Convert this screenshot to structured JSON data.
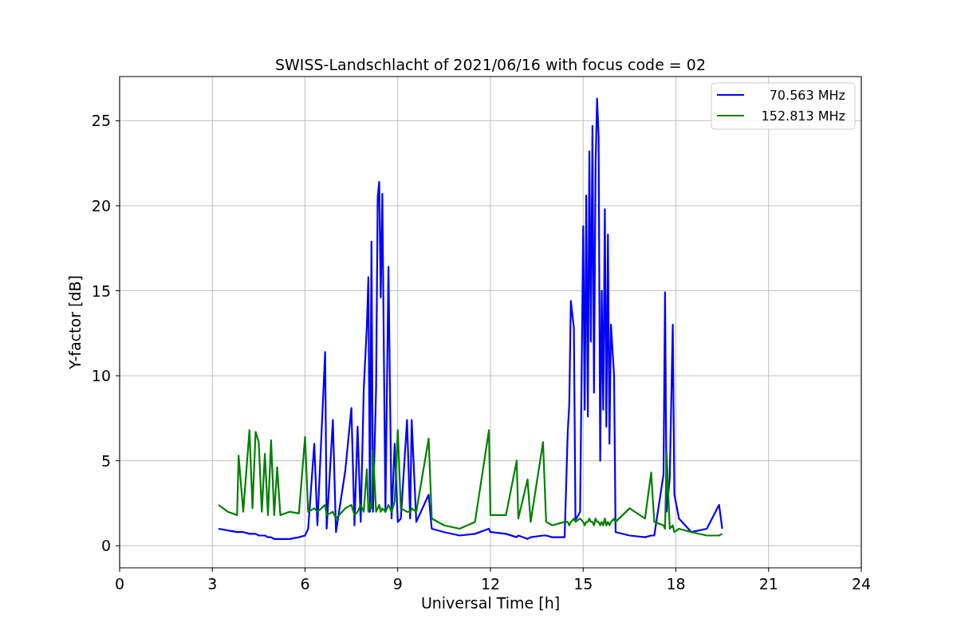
{
  "chart_data": {
    "type": "line",
    "title": "SWISS-Landschlacht of 2021/06/16 with focus code = 02",
    "xlabel": "Universal Time [h]",
    "ylabel": "Y-factor [dB]",
    "x": [
      3.2,
      3.5,
      3.8,
      3.85,
      4.0,
      4.2,
      4.3,
      4.4,
      4.5,
      4.6,
      4.7,
      4.8,
      4.9,
      5.0,
      5.1,
      5.2,
      5.5,
      5.8,
      6.0,
      6.1,
      6.3,
      6.4,
      6.65,
      6.7,
      6.9,
      7.0,
      7.3,
      7.5,
      7.6,
      7.7,
      7.8,
      7.9,
      8.0,
      8.05,
      8.1,
      8.15,
      8.2,
      8.3,
      8.35,
      8.4,
      8.45,
      8.5,
      8.6,
      8.7,
      8.8,
      8.9,
      9.0,
      9.1,
      9.3,
      9.4,
      9.45,
      9.6,
      10.0,
      10.1,
      10.5,
      11.0,
      11.5,
      11.95,
      12.0,
      12.5,
      12.85,
      12.9,
      13.2,
      13.3,
      13.7,
      13.8,
      14.0,
      14.4,
      14.5,
      14.55,
      14.6,
      14.7,
      14.75,
      14.9,
      15.0,
      15.05,
      15.1,
      15.15,
      15.2,
      15.25,
      15.3,
      15.35,
      15.4,
      15.45,
      15.5,
      15.55,
      15.6,
      15.65,
      15.7,
      15.75,
      15.8,
      15.85,
      15.9,
      16.0,
      16.05,
      16.5,
      17.0,
      17.2,
      17.3,
      17.6,
      17.65,
      17.7,
      17.8,
      17.9,
      17.95,
      18.1,
      18.5,
      19.0,
      19.4,
      19.5
    ],
    "series": [
      {
        "name": "70.563 MHz",
        "color": "#0000ff",
        "values": [
          1.0,
          0.9,
          0.8,
          0.8,
          0.8,
          0.7,
          0.7,
          0.7,
          0.6,
          0.6,
          0.6,
          0.5,
          0.5,
          0.4,
          0.4,
          0.4,
          0.4,
          0.5,
          0.6,
          1.0,
          6.0,
          1.2,
          11.4,
          1.0,
          7.4,
          0.8,
          4.4,
          8.1,
          1.2,
          7.0,
          1.4,
          9.2,
          12.9,
          15.8,
          2.0,
          17.9,
          2.0,
          9.3,
          20.5,
          21.4,
          14.6,
          20.7,
          2.0,
          16.4,
          1.6,
          6.0,
          1.4,
          1.6,
          7.4,
          1.6,
          7.4,
          1.4,
          3.0,
          1.0,
          0.8,
          0.6,
          0.7,
          1.0,
          0.8,
          0.7,
          0.5,
          0.6,
          0.4,
          0.5,
          0.6,
          0.6,
          0.5,
          0.5,
          6.7,
          8.3,
          14.4,
          12.8,
          1.5,
          2.0,
          18.8,
          8.0,
          20.6,
          7.6,
          23.2,
          12.0,
          24.7,
          9.0,
          22.5,
          26.3,
          24.1,
          5.0,
          15.0,
          8.0,
          19.8,
          7.0,
          18.3,
          6.0,
          13.0,
          10.0,
          0.8,
          0.6,
          0.5,
          0.6,
          0.6,
          4.2,
          14.9,
          2.0,
          4.0,
          13.0,
          3.0,
          1.6,
          0.8,
          1.0,
          2.4,
          1.0
        ]
      },
      {
        "name": "152.813 MHz",
        "color": "#008000",
        "values": [
          2.4,
          2.0,
          1.8,
          5.3,
          2.0,
          6.8,
          2.2,
          6.7,
          6.1,
          2.0,
          5.4,
          1.8,
          6.2,
          1.8,
          4.6,
          1.8,
          2.0,
          1.9,
          6.4,
          2.0,
          2.2,
          2.0,
          2.4,
          1.8,
          2.0,
          1.6,
          2.2,
          2.4,
          1.8,
          2.0,
          2.4,
          2.0,
          4.5,
          2.0,
          2.5,
          2.2,
          5.6,
          2.0,
          2.2,
          2.4,
          2.0,
          2.2,
          2.0,
          2.4,
          2.0,
          2.6,
          6.8,
          2.2,
          2.0,
          2.0,
          2.2,
          2.0,
          6.3,
          1.6,
          1.2,
          1.0,
          1.4,
          6.8,
          1.8,
          1.8,
          5.0,
          1.6,
          3.9,
          1.4,
          6.1,
          1.4,
          1.2,
          1.4,
          1.4,
          1.2,
          1.4,
          1.6,
          1.4,
          1.6,
          1.4,
          1.2,
          1.4,
          1.4,
          1.6,
          1.4,
          1.4,
          1.2,
          1.6,
          1.4,
          1.4,
          1.2,
          1.4,
          1.2,
          1.6,
          1.2,
          1.4,
          1.2,
          1.4,
          1.6,
          1.4,
          2.2,
          1.6,
          4.3,
          1.4,
          1.2,
          1.0,
          5.5,
          1.0,
          1.2,
          0.8,
          1.0,
          0.8,
          0.6,
          0.6,
          0.7
        ]
      }
    ],
    "grid": true,
    "legend": true,
    "xlim": [
      0,
      24
    ],
    "ylim": [
      -1.3,
      27.6
    ],
    "xticks": [
      0,
      3,
      6,
      9,
      12,
      15,
      18,
      21,
      24
    ],
    "yticks": [
      0,
      5,
      10,
      15,
      20,
      25
    ]
  }
}
